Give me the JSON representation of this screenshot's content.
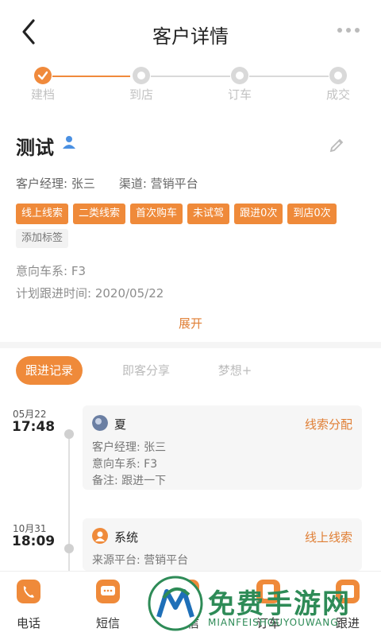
{
  "header": {
    "title": "客户详情"
  },
  "stepper": {
    "steps": [
      {
        "label": "建档",
        "status": "done"
      },
      {
        "label": "到店",
        "status": "todo"
      },
      {
        "label": "订车",
        "status": "todo"
      },
      {
        "label": "成交",
        "status": "todo"
      }
    ]
  },
  "customer": {
    "name": "测试",
    "manager": "客户经理: 张三",
    "channel": "渠道: 营销平台",
    "tags": [
      "线上线索",
      "二类线索",
      "首次购车",
      "未试驾",
      "跟进0次",
      "到店0次"
    ],
    "add_tag": "添加标签",
    "intent_series": "意向车系: F3",
    "plan_time": "计划跟进时间: 2020/05/22",
    "expand": "展开"
  },
  "tabs": [
    {
      "label": "跟进记录",
      "active": true
    },
    {
      "label": "即客分享",
      "active": false
    },
    {
      "label": "梦想+",
      "active": false
    }
  ],
  "records": [
    {
      "date": "05月22",
      "time": "17:48",
      "who": "夏",
      "kind": "线索分配",
      "lines": [
        "客户经理: 张三",
        "意向车系: F3",
        "备注: 跟进一下"
      ]
    },
    {
      "date": "10月31",
      "time": "18:09",
      "who": "系统",
      "kind": "线上线索",
      "lines": [
        "来源平台: 营销平台"
      ]
    }
  ],
  "bottom_bar": [
    {
      "label": "电话",
      "icon": "phone-icon"
    },
    {
      "label": "短信",
      "icon": "sms-icon"
    },
    {
      "label": "微信",
      "icon": "wechat-icon"
    },
    {
      "label": "订车",
      "icon": "order-icon"
    },
    {
      "label": "跟进",
      "icon": "follow-icon"
    }
  ],
  "watermark": {
    "text": "免费手游网",
    "sub": "MIANFEISHOUYOUWANG"
  },
  "colors": {
    "accent": "#ef8a3a",
    "accent_text": "#e07f35",
    "muted": "#c2c2c2",
    "divider": "#f5f5f5"
  }
}
